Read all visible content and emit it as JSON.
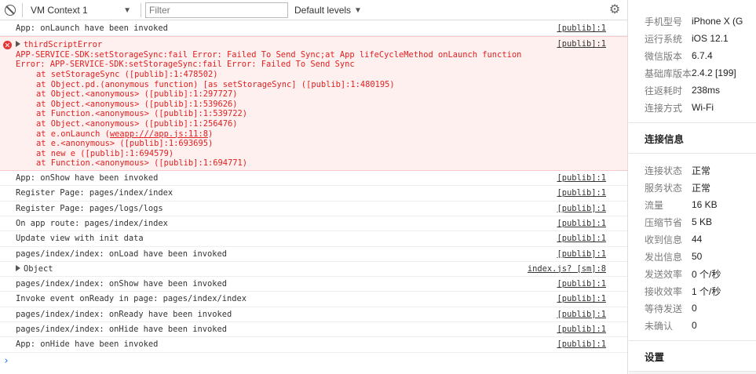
{
  "toolbar": {
    "context_label": "VM Context 1",
    "filter_placeholder": "Filter",
    "levels_label": "Default levels"
  },
  "messages": [
    {
      "type": "log",
      "text": "App: onLaunch have been invoked",
      "source": "[publib]:1"
    },
    {
      "type": "error",
      "title": "thirdScriptError",
      "source": "[publib]:1",
      "lines": [
        "APP-SERVICE-SDK:setStorageSync:fail Error: Failed To Send Sync;at App lifeCycleMethod onLaunch function",
        "Error: APP-SERVICE-SDK:setStorageSync:fail Error: Failed To Send Sync",
        "at setStorageSync ([publib]:1:478502)",
        "at Object.pd.(anonymous function) [as setStorageSync] ([publib]:1:480195)",
        "at Object.<anonymous> ([publib]:1:297727)",
        "at Object.<anonymous> ([publib]:1:539626)",
        "at Function.<anonymous> ([publib]:1:539722)",
        "at Object.<anonymous> ([publib]:1:256476)",
        "at e.onLaunch (",
        "at e.<anonymous> ([publib]:1:693695)",
        "at new e ([publib]:1:694579)",
        "at Function.<anonymous> ([publib]:1:694771)"
      ],
      "link_text": "weapp:///app.js:11:8",
      "link_suffix": ")"
    },
    {
      "type": "log",
      "text": "App: onShow have been invoked",
      "source": "[publib]:1"
    },
    {
      "type": "log",
      "text": "Register Page: pages/index/index",
      "source": "[publib]:1"
    },
    {
      "type": "log",
      "text": "Register Page: pages/logs/logs",
      "source": "[publib]:1"
    },
    {
      "type": "log",
      "text": "On app route: pages/index/index",
      "source": "[publib]:1"
    },
    {
      "type": "log",
      "text": "Update view with init data",
      "source": "[publib]:1"
    },
    {
      "type": "log",
      "text": "pages/index/index: onLoad have been invoked",
      "source": "[publib]:1"
    },
    {
      "type": "object",
      "text": "Object",
      "source": "index.js? [sm]:8"
    },
    {
      "type": "log",
      "text": "pages/index/index: onShow have been invoked",
      "source": "[publib]:1"
    },
    {
      "type": "log",
      "text": "Invoke event onReady in page: pages/index/index",
      "source": "[publib]:1"
    },
    {
      "type": "log",
      "text": "pages/index/index: onReady have been invoked",
      "source": "[publib]:1"
    },
    {
      "type": "log",
      "text": "pages/index/index: onHide have been invoked",
      "source": "[publib]:1"
    },
    {
      "type": "log",
      "text": "App: onHide have been invoked",
      "source": "[publib]:1"
    }
  ],
  "prompt": "›",
  "device": [
    {
      "key": "手机型号",
      "value": "iPhone X (G"
    },
    {
      "key": "运行系统",
      "value": "iOS 12.1"
    },
    {
      "key": "微信版本",
      "value": "6.7.4"
    },
    {
      "key": "基础库版本",
      "value": "2.4.2 [199]"
    },
    {
      "key": "往返耗时",
      "value": "238ms"
    },
    {
      "key": "连接方式",
      "value": "Wi-Fi"
    }
  ],
  "connection_title": "连接信息",
  "connection": [
    {
      "key": "连接状态",
      "value": "正常"
    },
    {
      "key": "服务状态",
      "value": "正常"
    },
    {
      "key": "流量",
      "value": "16 KB"
    },
    {
      "key": "压缩节省",
      "value": "5 KB"
    },
    {
      "key": "收到信息",
      "value": "44"
    },
    {
      "key": "发出信息",
      "value": "50"
    },
    {
      "key": "发送效率",
      "value": "0 个/秒"
    },
    {
      "key": "接收效率",
      "value": "1 个/秒"
    },
    {
      "key": "等待发送",
      "value": "0"
    },
    {
      "key": "未确认",
      "value": "0"
    }
  ],
  "settings_title": "设置",
  "colors": {
    "error_text": "#e02020",
    "error_bg": "#fff0f0",
    "link_blue": "#1a73e8"
  }
}
